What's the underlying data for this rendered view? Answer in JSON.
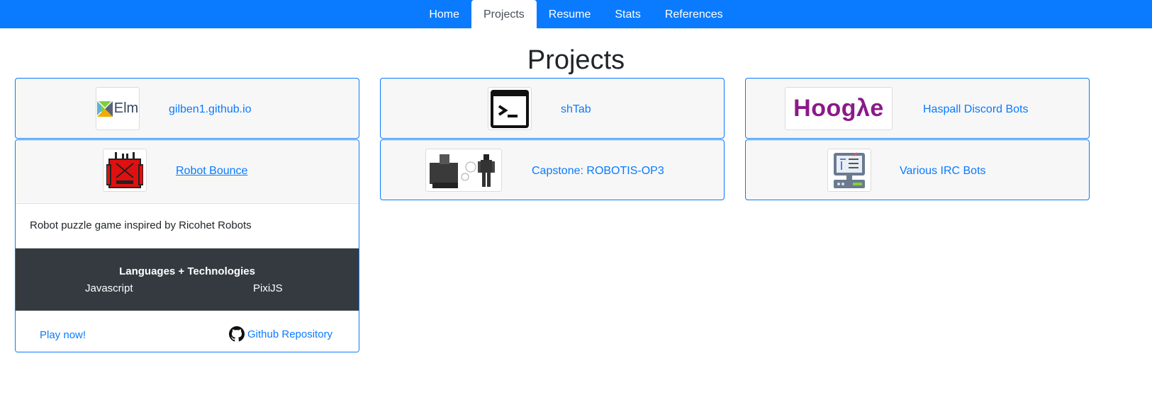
{
  "nav": {
    "items": [
      {
        "label": "Home",
        "active": false
      },
      {
        "label": "Projects",
        "active": true
      },
      {
        "label": "Resume",
        "active": false
      },
      {
        "label": "Stats",
        "active": false
      },
      {
        "label": "References",
        "active": false
      }
    ]
  },
  "page": {
    "title": "Projects"
  },
  "projects": [
    {
      "title": "gilben1.github.io",
      "icon": "elm-logo-icon",
      "logo_text": "Elm"
    },
    {
      "title": "shTab",
      "icon": "terminal-icon"
    },
    {
      "title": "Haspall Discord Bots",
      "icon": "hoogle-logo-icon",
      "logo_text": "Hoogλe"
    },
    {
      "title": "Robot Bounce",
      "icon": "red-robot-icon",
      "description": "Robot puzzle game inspired by Ricohet Robots",
      "tech_heading": "Languages + Technologies",
      "technologies": [
        "Javascript",
        "PixiJS"
      ],
      "play_label": "Play now!",
      "repo_label": "Github Repository"
    },
    {
      "title": "Capstone: ROBOTIS-OP3",
      "icon": "robots-photo-icon"
    },
    {
      "title": "Various IRC Bots",
      "icon": "server-icon"
    }
  ],
  "colors": {
    "accent": "#0a7bff",
    "dark": "#343a40",
    "card_bg": "#f7f7f7"
  }
}
